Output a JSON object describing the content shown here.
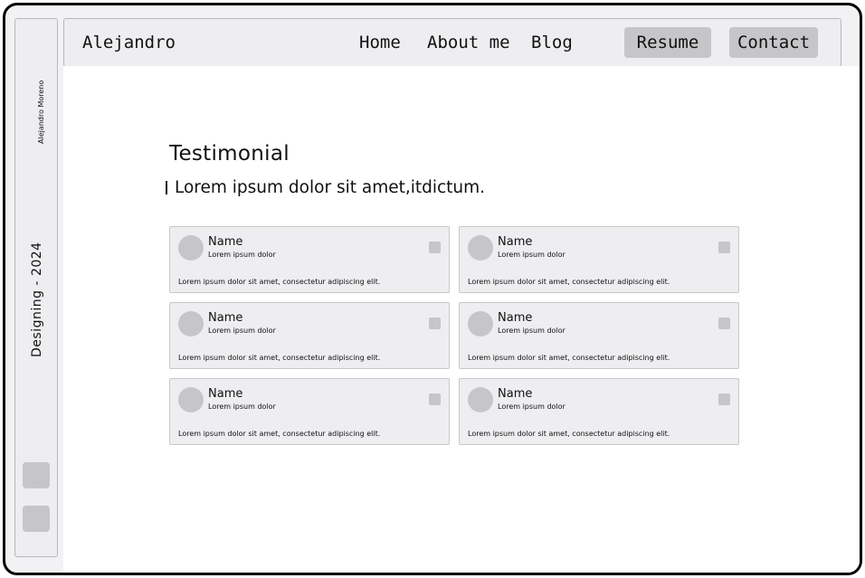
{
  "sidebar": {
    "name": "Alejandro Moreno",
    "tagline": "Designing - 2024"
  },
  "nav": {
    "brand": "Alejandro",
    "links": [
      "Home",
      "About me",
      "Blog"
    ],
    "resume_label": "Resume",
    "contact_label": "Contact"
  },
  "main": {
    "title": "Testimonial",
    "subtitle": "Lorem ipsum dolor sit amet,itdictum."
  },
  "testimonials": [
    {
      "name": "Name",
      "role": "Lorem ipsum dolor",
      "text": "Lorem ipsum dolor sit amet, consectetur adipiscing elit."
    },
    {
      "name": "Name",
      "role": "Lorem ipsum dolor",
      "text": "Lorem ipsum dolor sit amet, consectetur adipiscing elit."
    },
    {
      "name": "Name",
      "role": "Lorem ipsum dolor",
      "text": "Lorem ipsum dolor sit amet, consectetur adipiscing elit."
    },
    {
      "name": "Name",
      "role": "Lorem ipsum dolor",
      "text": "Lorem ipsum dolor sit amet, consectetur adipiscing elit."
    },
    {
      "name": "Name",
      "role": "Lorem ipsum dolor",
      "text": "Lorem ipsum dolor sit amet, consectetur adipiscing elit."
    },
    {
      "name": "Name",
      "role": "Lorem ipsum dolor",
      "text": "Lorem ipsum dolor sit amet, consectetur adipiscing elit."
    }
  ],
  "colors": {
    "panel": "#eeeef1",
    "placeholder": "#c6c6c9",
    "frame": "#000000"
  }
}
